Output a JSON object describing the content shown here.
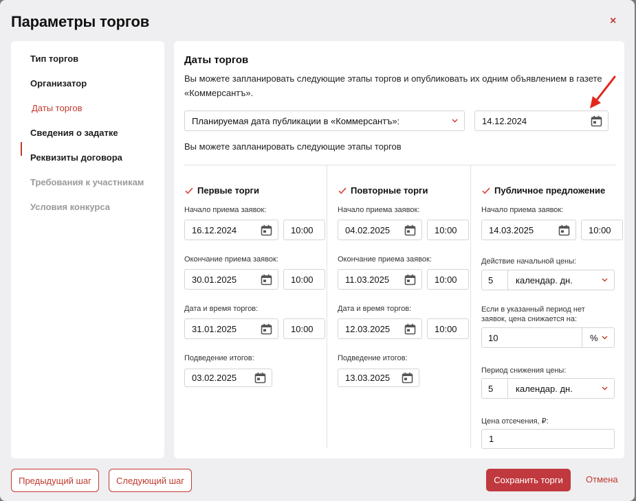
{
  "modal": {
    "title": "Параметры торгов",
    "close_label": "×"
  },
  "sidebar": {
    "items": [
      {
        "label": "Тип торгов",
        "state": "normal"
      },
      {
        "label": "Организатор",
        "state": "normal"
      },
      {
        "label": "Даты торгов",
        "state": "active"
      },
      {
        "label": "Сведения о задатке",
        "state": "normal"
      },
      {
        "label": "Реквизиты договора",
        "state": "normal"
      },
      {
        "label": "Требования к участникам",
        "state": "disabled"
      },
      {
        "label": "Условия конкурса",
        "state": "disabled"
      }
    ]
  },
  "main": {
    "heading": "Даты торгов",
    "description": "Вы можете запланировать следующие этапы торгов и опубликовать их одним объявлением в газете «Коммерсантъ».",
    "publication_select": "Планируемая дата публикации в «Коммерсантъ»:",
    "publication_date": "14.12.2024",
    "stages_note": "Вы можете запланировать следующие этапы торгов"
  },
  "first": {
    "title": "Первые торги",
    "start_label": "Начало приема заявок:",
    "start_date": "16.12.2024",
    "start_time": "10:00",
    "end_label": "Окончание приема заявок:",
    "end_date": "30.01.2025",
    "end_time": "10:00",
    "trade_label": "Дата и время торгов:",
    "trade_date": "31.01.2025",
    "trade_time": "10:00",
    "results_label": "Подведение итогов:",
    "results_date": "03.02.2025"
  },
  "repeat": {
    "title": "Повторные торги",
    "start_label": "Начало приема заявок:",
    "start_date": "04.02.2025",
    "start_time": "10:00",
    "end_label": "Окончание приема заявок:",
    "end_date": "11.03.2025",
    "end_time": "10:00",
    "trade_label": "Дата и время торгов:",
    "trade_date": "12.03.2025",
    "trade_time": "10:00",
    "results_label": "Подведение итогов:",
    "results_date": "13.03.2025"
  },
  "public": {
    "title": "Публичное предложение",
    "start_label": "Начало приема заявок:",
    "start_date": "14.03.2025",
    "start_time": "10:00",
    "price_action_label": "Действие начальной цены:",
    "price_action_value": "5",
    "price_action_unit": "календар. дн.",
    "decrease_label_1": "Если в указанный период нет",
    "decrease_label_2": "заявок, цена снижается на:",
    "decrease_value": "10",
    "decrease_unit": "%",
    "period_label": "Период снижения цены:",
    "period_value": "5",
    "period_unit": "календар. дн.",
    "cutoff_label": "Цена отсечения, ₽:",
    "cutoff_value": "1"
  },
  "footer": {
    "prev_label": "Предыдущий шаг",
    "next_label": "Следующий шаг",
    "save_label": "Сохранить торги",
    "cancel_label": "Отмена"
  },
  "colors": {
    "accent": "#c0392b",
    "checkbox": "#d9534f"
  }
}
